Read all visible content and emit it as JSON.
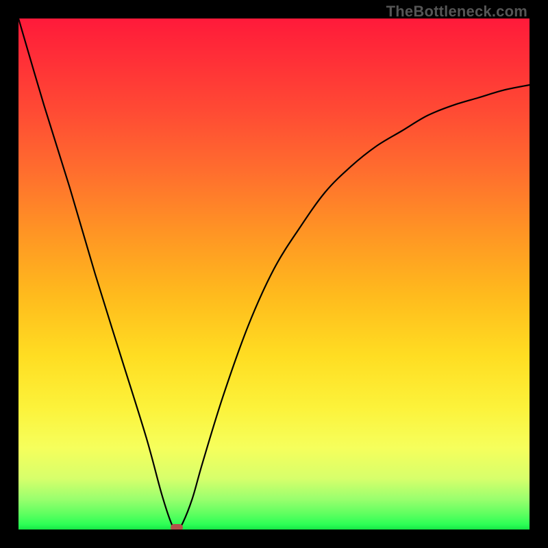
{
  "watermark": "TheBottleneck.com",
  "chart_data": {
    "type": "line",
    "title": "",
    "xlabel": "",
    "ylabel": "",
    "xlim": [
      0,
      100
    ],
    "ylim": [
      0,
      100
    ],
    "grid": false,
    "legend": false,
    "series": [
      {
        "name": "curve",
        "x": [
          0,
          5,
          10,
          15,
          20,
          25,
          28,
          30,
          31,
          32,
          34,
          36,
          40,
          45,
          50,
          55,
          60,
          65,
          70,
          75,
          80,
          85,
          90,
          95,
          100
        ],
        "y": [
          100,
          83,
          67,
          50,
          34,
          18,
          7,
          1,
          0,
          1,
          6,
          13,
          26,
          40,
          51,
          59,
          66,
          71,
          75,
          78,
          81,
          83,
          84.5,
          86,
          87
        ]
      }
    ],
    "marker": {
      "x": 31,
      "y": 0,
      "color": "#b3524b"
    },
    "background_gradient": {
      "top": "#ff1a3a",
      "mid": "#ffdd22",
      "bottom": "#16e646"
    }
  }
}
